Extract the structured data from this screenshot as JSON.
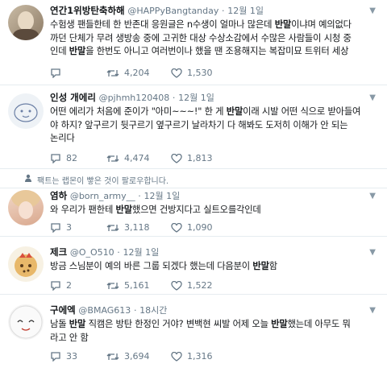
{
  "tweets": [
    {
      "name": "연간1위방탄축하해",
      "handle": "@HAPPyBangtanday",
      "time": "12월 1일",
      "lines": [
        {
          "pre": "수험생 팬들한테 한 반존대 응원글은 n수생이 얼마나 많은데 ",
          "kw": "반말",
          "post": "이냐며 예의없다"
        },
        {
          "pre": "까던 단체가 무려 생방송 중에 고귀한 대상 수상소감에서 수많은 사람들이 시청 중",
          "kw": "",
          "post": ""
        },
        {
          "pre": "인데 ",
          "kw": "반말",
          "post": "을 한번도 아니고 여러번이나 했을 땐 조용해지는 복잡미묘 트위터 세상"
        }
      ],
      "replies": "",
      "retweets": "4,204",
      "likes": "1,530"
    },
    {
      "name": "인성 개에리",
      "handle": "@pjhmh120408",
      "time": "12월 1일",
      "lines": [
        {
          "pre": "어떤 에리가 처음에 준이가 \"아미~~~!\" 한 게 ",
          "kw": "반말",
          "post": "이래 시발 어떤 식으로 받아들여"
        },
        {
          "pre": "야 하지? 앞구르기 뒷구르기 옆구르기 날라차기 다 해봐도 도저히 이해가 안 되는",
          "kw": "",
          "post": ""
        },
        {
          "pre": "논리다",
          "kw": "",
          "post": ""
        }
      ],
      "replies": "82",
      "retweets": "4,474",
      "likes": "1,813"
    },
    {
      "name": "염하",
      "handle": "@born_army__",
      "time": "12월 1일",
      "lines": [
        {
          "pre": "와 우리가 팬한테 ",
          "kw": "반말",
          "post": "했으면 건방지다고 실트오를각인데"
        }
      ],
      "replies": "3",
      "retweets": "3,118",
      "likes": "1,090"
    },
    {
      "name": "제크",
      "handle": "@O_O510",
      "time": "12월 1일",
      "lines": [
        {
          "pre": "방금 스님분이 예의 바른 그룹 되겠다 했는데 다음분이 ",
          "kw": "반말",
          "post": "함"
        }
      ],
      "replies": "2",
      "retweets": "5,161",
      "likes": "1,522"
    },
    {
      "name": "구에엑",
      "handle": "@BMAG613",
      "time": "18시간",
      "lines": [
        {
          "pre": "남돌 ",
          "kw": "반말",
          "post": " 직캠은 방탄 한정인 거야? 변백현 씨발 어제 오늘 "
        },
        {
          "pre": "라고 안 함",
          "kw": "",
          "post": ""
        }
      ],
      "line0_extra": {
        "kw2": "반말",
        "post2": "했는데 아무도 뭐"
      },
      "replies": "33",
      "retweets": "3,694",
      "likes": "1,316"
    }
  ],
  "notice": "팩트는 랩몬이 빻은 것이 팔로우합니다.",
  "colors": {
    "retweet": "#17bf63",
    "icon": "#657786",
    "name": "#14171a"
  },
  "icons": [
    "reply-icon",
    "retweet-icon",
    "like-icon",
    "caret-down-icon",
    "following-icon"
  ]
}
